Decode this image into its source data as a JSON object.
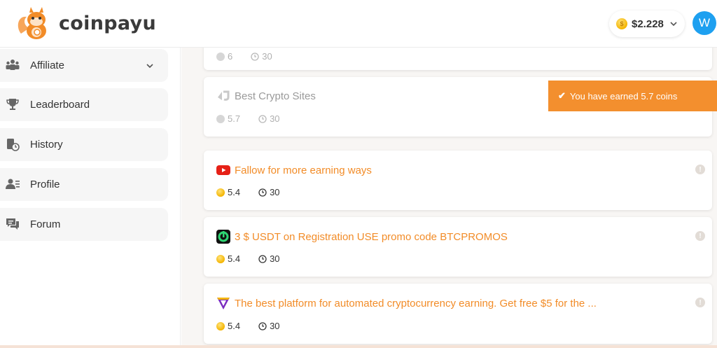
{
  "header": {
    "brand": "coinpayu",
    "balance": "$2.228",
    "avatar_letter": "W"
  },
  "sidebar": {
    "items": [
      {
        "label": "Affiliate",
        "icon": "users-icon",
        "has_dropdown": true
      },
      {
        "label": "Leaderboard",
        "icon": "trophy-icon"
      },
      {
        "label": "History",
        "icon": "history-icon"
      },
      {
        "label": "Profile",
        "icon": "profile-icon"
      },
      {
        "label": "Forum",
        "icon": "forum-icon"
      }
    ]
  },
  "toast": {
    "message": "You have earned 5.7 coins"
  },
  "cards": [
    {
      "title": "",
      "reward": "6",
      "duration": "30",
      "faded": true
    },
    {
      "title": "Best Crypto Sites",
      "reward": "5.7",
      "duration": "30",
      "faded": true,
      "icon": "best-crypto-sites-logo-icon"
    },
    {
      "title": "Fallow for more earning ways",
      "reward": "5.4",
      "duration": "30",
      "icon": "youtube-icon"
    },
    {
      "title": "3 $ USDT on Registration USE promo code BTCPROMOS",
      "reward": "5.4",
      "duration": "30",
      "icon": "green-exchange-logo-icon"
    },
    {
      "title": "The best platform for automated cryptocurrency earning. Get free $5 for the ...",
      "reward": "5.4",
      "duration": "30",
      "icon": "purple-triangle-logo-icon"
    }
  ],
  "colors": {
    "accent": "#f28c28",
    "toast": "#f38f2e",
    "avatar": "#1ea0f0"
  }
}
